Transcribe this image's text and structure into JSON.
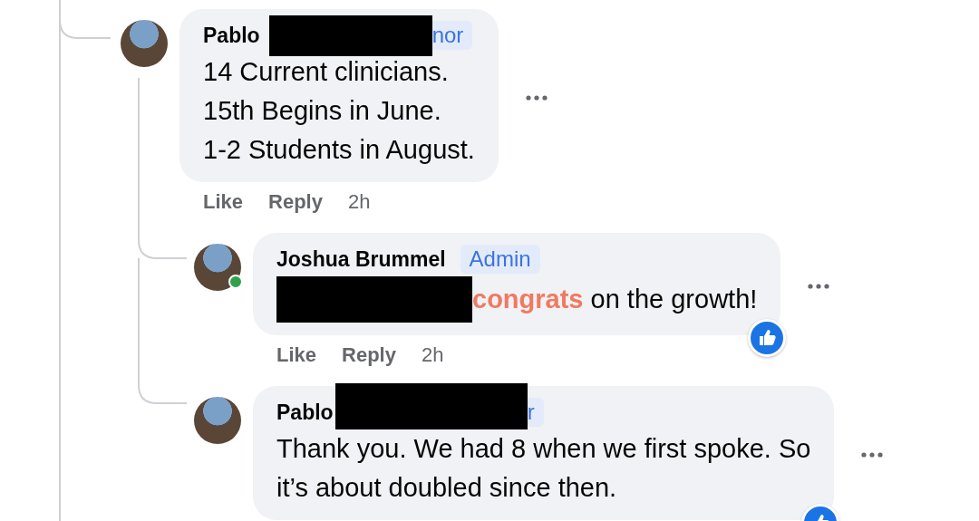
{
  "comments": [
    {
      "author": "Pablo",
      "badge": "nor",
      "name_redacted": true,
      "text_redacted": false,
      "online": false,
      "reaction": false,
      "lines": [
        "14 Current clinicians.",
        "15th Begins in June.",
        "1-2 Students in August."
      ],
      "actions": [
        "Like",
        "Reply"
      ],
      "time": "2h",
      "reply": false
    },
    {
      "author": "Joshua Brummel",
      "badge": "Admin",
      "name_redacted": false,
      "text_redacted": true,
      "online": true,
      "reaction": true,
      "lines": [
        "**congrats** on the growth!"
      ],
      "actions": [
        "Like",
        "Reply"
      ],
      "time": "2h",
      "reply": true
    },
    {
      "author": "Pablo",
      "badge": "r",
      "name_redacted": true,
      "text_redacted": false,
      "online": false,
      "reaction": true,
      "lines": [
        "Thank you. We had 8 when we first spoke. So",
        "it’s about doubled since then."
      ],
      "reply": true
    }
  ]
}
